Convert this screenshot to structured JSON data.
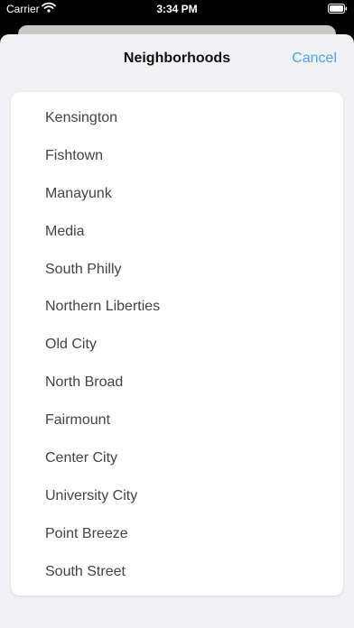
{
  "status_bar": {
    "carrier": "Carrier",
    "time": "3:34 PM"
  },
  "nav": {
    "title": "Neighborhoods",
    "cancel_label": "Cancel"
  },
  "neighborhoods": [
    "Kensington",
    "Fishtown",
    "Manayunk",
    "Media",
    "South Philly",
    "Northern Liberties",
    "Old City",
    "North Broad",
    "Fairmount",
    "Center City",
    "University City",
    "Point Breeze",
    "South Street"
  ],
  "colors": {
    "accent": "#4aa3e6",
    "sheet_background": "#f2f2f4",
    "list_background": "#ffffff",
    "text": "#444448"
  },
  "icons": {
    "wifi": "wifi-icon",
    "battery": "battery-icon"
  }
}
